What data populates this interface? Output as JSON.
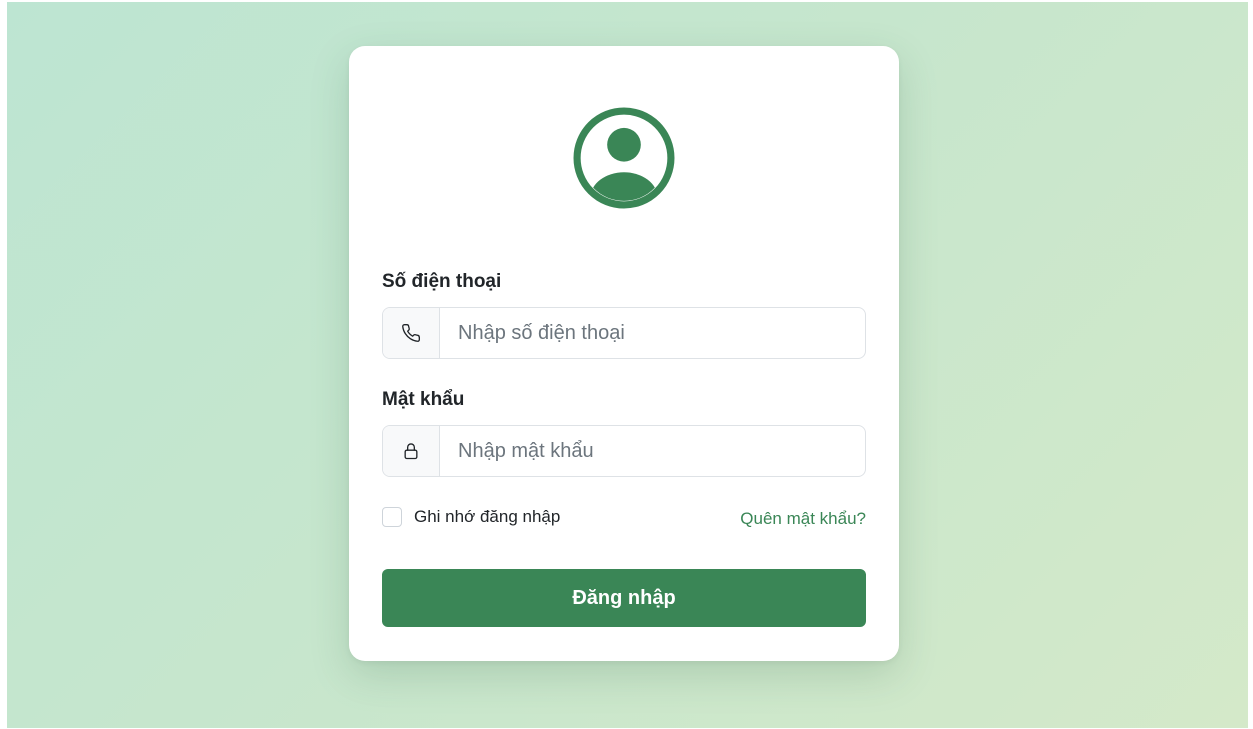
{
  "login": {
    "phone": {
      "label": "Số điện thoại",
      "placeholder": "Nhập số điện thoại",
      "value": "",
      "icon": "phone-icon"
    },
    "password": {
      "label": "Mật khẩu",
      "placeholder": "Nhập mật khẩu",
      "value": "",
      "icon": "lock-icon"
    },
    "remember": {
      "label": "Ghi nhớ đăng nhập",
      "checked": false
    },
    "forgot_link": "Quên mật khẩu?",
    "submit_label": "Đăng nhập",
    "avatar_icon": "user-circle-icon"
  },
  "colors": {
    "brand": "#3a8656",
    "background_start": "#bde5d2",
    "background_end": "#d4e9c9",
    "card": "#ffffff",
    "addon_bg": "#f8f9fa",
    "border": "#dee2e6"
  }
}
